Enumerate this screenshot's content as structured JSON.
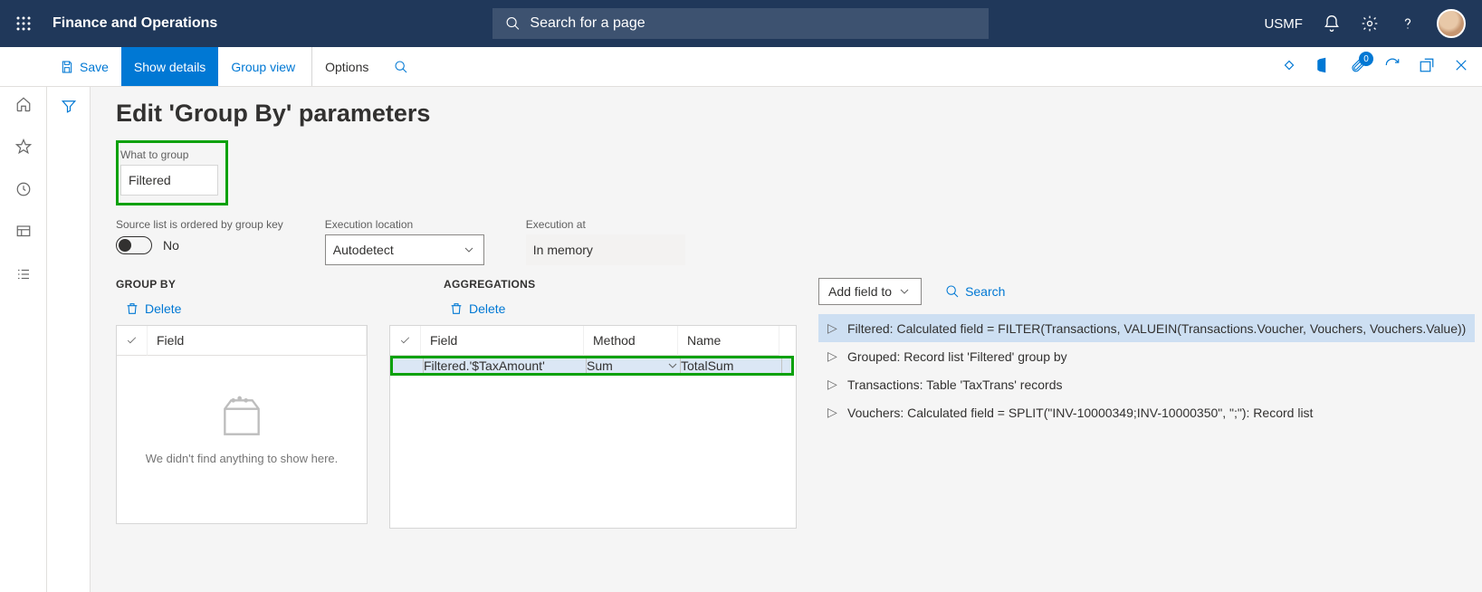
{
  "header": {
    "app_title": "Finance and Operations",
    "search_placeholder": "Search for a page",
    "company": "USMF"
  },
  "actionbar": {
    "save": "Save",
    "show_details": "Show details",
    "group_view": "Group view",
    "options": "Options",
    "attach_badge": "0"
  },
  "page": {
    "title": "Edit 'Group By' parameters"
  },
  "what_to_group": {
    "label": "What to group",
    "value": "Filtered"
  },
  "ordered": {
    "label": "Source list is ordered by group key",
    "value": "No"
  },
  "exec_location": {
    "label": "Execution location",
    "value": "Autodetect"
  },
  "exec_at": {
    "label": "Execution at",
    "value": "In memory"
  },
  "groupby": {
    "title": "GROUP BY",
    "delete": "Delete",
    "col_field": "Field",
    "empty_msg": "We didn't find anything to show here."
  },
  "agg": {
    "title": "AGGREGATIONS",
    "delete": "Delete",
    "col_field": "Field",
    "col_method": "Method",
    "col_name": "Name",
    "rows": [
      {
        "field": "Filtered.'$TaxAmount'",
        "method": "Sum",
        "name": "TotalSum"
      }
    ]
  },
  "tree": {
    "add_button": "Add field to",
    "search": "Search",
    "items": [
      "Filtered: Calculated field = FILTER(Transactions, VALUEIN(Transactions.Voucher, Vouchers, Vouchers.Value))",
      "Grouped: Record list 'Filtered' group by",
      "Transactions: Table 'TaxTrans' records",
      "Vouchers: Calculated field = SPLIT(\"INV-10000349;INV-10000350\", \";\"): Record list"
    ]
  }
}
